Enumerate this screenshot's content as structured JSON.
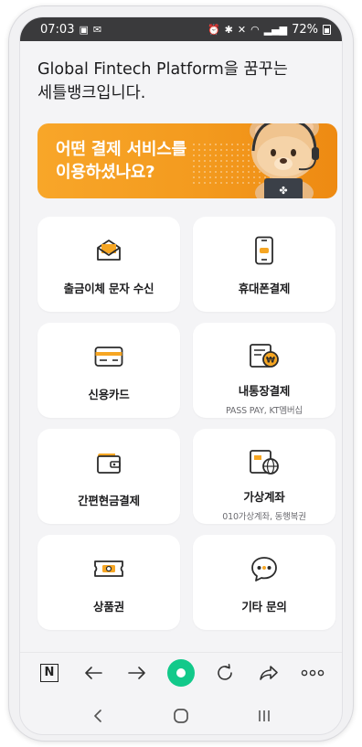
{
  "status_bar": {
    "time": "07:03",
    "battery": "72%"
  },
  "greeting": {
    "line1": "Global Fintech Platform을 꿈꾸는",
    "line2": "세틀뱅크입니다."
  },
  "banner": {
    "line1": "어떤 결제 서비스를",
    "line2": "이용하셨나요?"
  },
  "menu": [
    {
      "label": "출금이체 문자 수신",
      "sub": "",
      "icon": "envelope-icon"
    },
    {
      "label": "휴대폰결제",
      "sub": "",
      "icon": "mobile-phone-icon"
    },
    {
      "label": "신용카드",
      "sub": "",
      "icon": "credit-card-icon"
    },
    {
      "label": "내통장결제",
      "sub": "PASS PAY, KT멤버십",
      "icon": "bank-book-coin-icon"
    },
    {
      "label": "간편현금결제",
      "sub": "",
      "icon": "wallet-icon"
    },
    {
      "label": "가상계좌",
      "sub": "010가상계좌, 동행복권",
      "icon": "virtual-account-globe-icon"
    },
    {
      "label": "상품권",
      "sub": "",
      "icon": "gift-voucher-icon"
    },
    {
      "label": "기타 문의",
      "sub": "",
      "icon": "chat-bubble-icon"
    }
  ],
  "browser_toolbar": {
    "home_letter": "N",
    "icons": [
      "naver-home-icon",
      "back-arrow-icon",
      "forward-arrow-icon",
      "green-dot-icon",
      "refresh-icon",
      "share-icon",
      "more-icon"
    ]
  },
  "colors": {
    "banner_orange": "#f39a1e",
    "accent_green": "#12c98a",
    "icon_dark": "#2b2b2b",
    "icon_accent": "#f6a623"
  }
}
